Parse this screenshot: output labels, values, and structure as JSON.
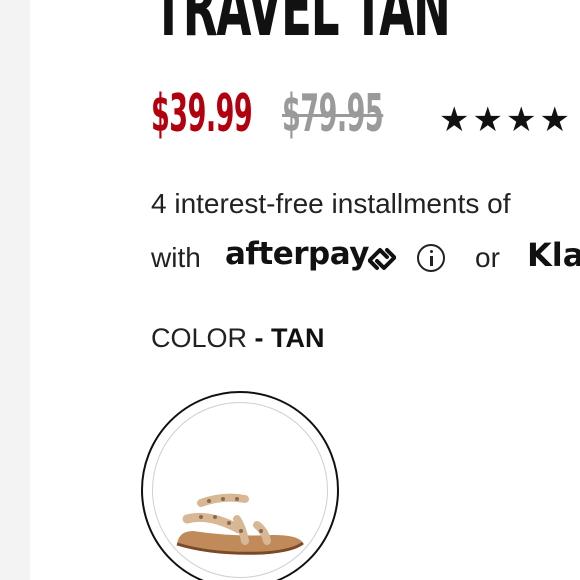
{
  "product": {
    "title": "TRAVEL TAN",
    "sale_price": "$39.99",
    "original_price": "$79.95",
    "stars": "★★★★",
    "rating_fraction_visible": 4
  },
  "payment": {
    "installments_text": "4 interest-free installments of",
    "with_label": "with",
    "afterpay_label": "afterpay",
    "or_label": "or",
    "klarna_label": "Kla"
  },
  "color": {
    "label": "COLOR",
    "separator": " - ",
    "value": "TAN"
  },
  "icons": {
    "afterpay": "afterpay-arrows-icon",
    "info": "info-icon",
    "star": "star-icon"
  },
  "colors": {
    "sale": "#b3000f",
    "original": "#9a9a9a",
    "text": "#222222"
  }
}
